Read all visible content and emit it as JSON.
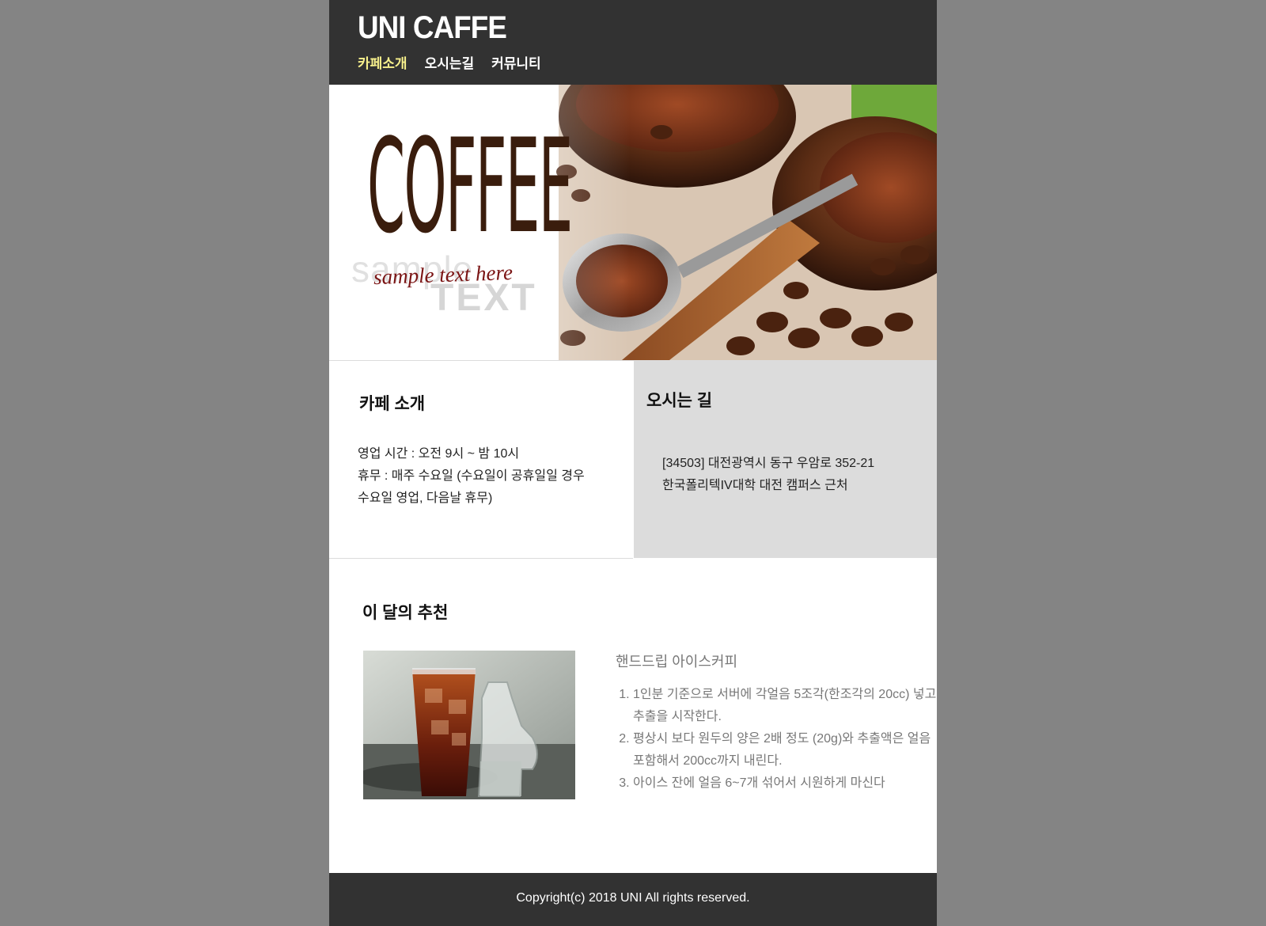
{
  "header": {
    "logo": "UNI CAFFE",
    "nav": [
      {
        "label": "카페소개",
        "active": true
      },
      {
        "label": "오시는길",
        "active": false
      },
      {
        "label": "커뮤니티",
        "active": false
      }
    ],
    "active_color": "#f8f18c"
  },
  "hero": {
    "title": "COFFEE",
    "ghost_text_1": "sample",
    "ghost_text_2": "TEXT",
    "tagline": "sample text here"
  },
  "intro": {
    "title": "카페 소개",
    "lines": [
      "영업 시간 : 오전 9시 ~ 밤 10시",
      "휴무 : 매주 수요일 (수요일이 공휴일일 경우",
      "수요일 영업, 다음날 휴무)"
    ]
  },
  "directions": {
    "title": "오시는 길",
    "lines": [
      "[34503] 대전광역시 동구 우암로 352-21",
      "한국폴리텍IV대학 대전 캠퍼스 근처"
    ]
  },
  "recommend": {
    "title": "이 달의 추천",
    "drink_name": "핸드드립 아이스커피",
    "steps": [
      "1인분 기준으로 서버에 각얼음 5조각(한조각의 20cc) 넣고 추출을 시작한다.",
      "평상시 보다 원두의 양은 2배 정도 (20g)와 추출액은 얼음 포함해서 200cc까지 내린다.",
      "아이스 잔에 얼음 6~7개 섞어서 시원하게 마신다"
    ]
  },
  "footer": {
    "copyright": "Copyright(c) 2018 UNI All rights reserved."
  }
}
